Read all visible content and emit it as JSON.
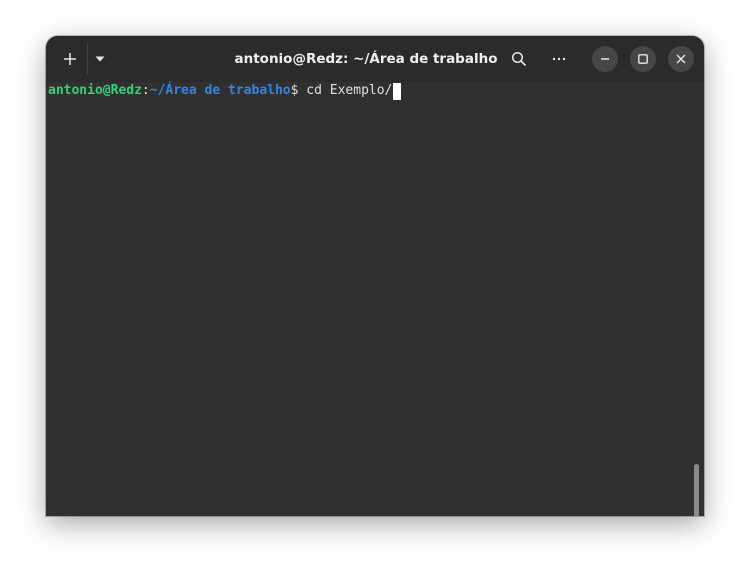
{
  "window": {
    "title": "antonio@Redz: ~/Área de trabalho"
  },
  "headerbar": {
    "new_tab_icon": "plus-icon",
    "tab_menu_icon": "caret-down-icon",
    "search_icon": "search-icon",
    "menu_icon": "ellipsis-icon",
    "minimize_icon": "minimize-icon",
    "maximize_icon": "maximize-icon",
    "close_icon": "close-icon"
  },
  "terminal": {
    "prompt_user": "antonio@Redz",
    "prompt_colon": ":",
    "prompt_path": "~/Área de trabalho",
    "prompt_symbol": "$",
    "command": " cd Exemplo/"
  },
  "colors": {
    "background": "#303030",
    "headerbar": "#2b2b2b",
    "prompt_user": "#33d17a",
    "prompt_path": "#3584e4",
    "text": "#e0e0e0"
  }
}
